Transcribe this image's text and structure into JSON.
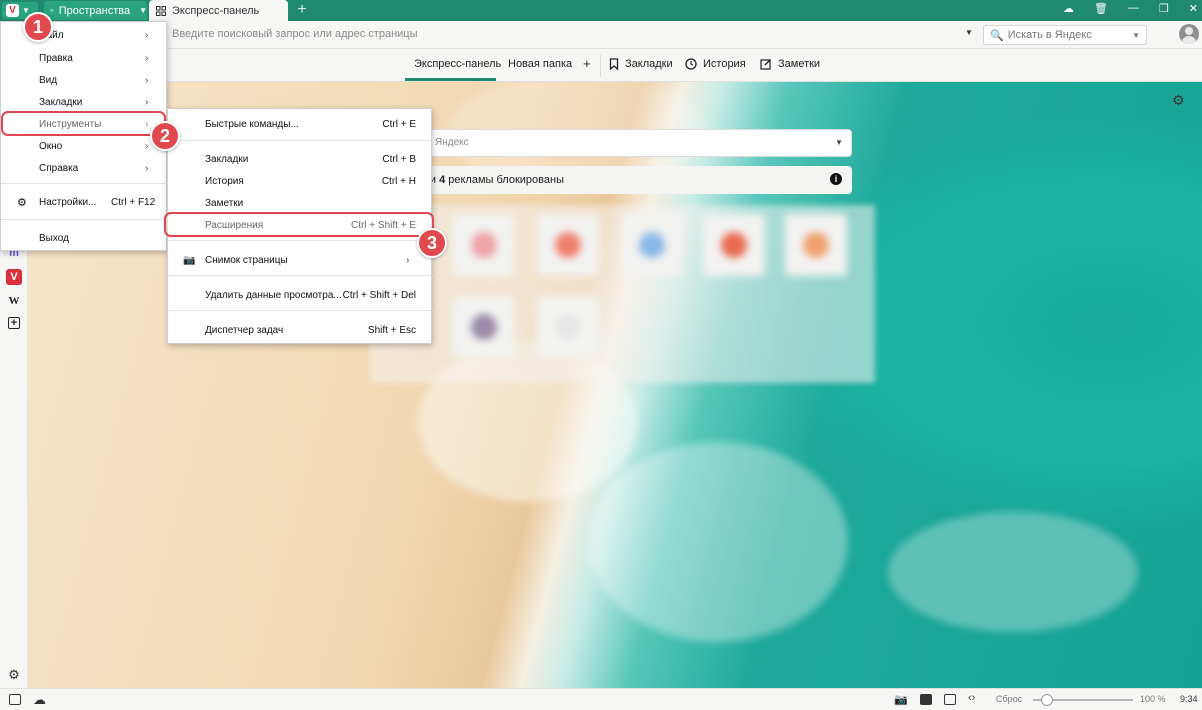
{
  "tabbar": {
    "spaces_label": "Пространства",
    "active_tab_label": "Экспресс-панель",
    "new_tab_symbol": "+"
  },
  "addressbar": {
    "url_placeholder": "Введите поисковый запрос или адрес страницы",
    "search_placeholder": "Искать в Яндекс"
  },
  "bookmarks_bar": {
    "items": [
      "Экспресс-панель",
      "Новая папка",
      "+"
    ],
    "tools": [
      "Закладки",
      "История",
      "Заметки"
    ]
  },
  "main_menu": {
    "items": [
      {
        "label": "Файл"
      },
      {
        "label": "Правка"
      },
      {
        "label": "Вид"
      },
      {
        "label": "Закладки"
      },
      {
        "label": "Инструменты"
      },
      {
        "label": "Окно"
      },
      {
        "label": "Справка"
      }
    ],
    "settings": {
      "label": "Настройки...",
      "shortcut": "Ctrl + F12"
    },
    "exit": {
      "label": "Выход"
    }
  },
  "tools_menu": {
    "items": [
      {
        "label": "Быстрые команды...",
        "shortcut": "Ctrl + E"
      },
      {
        "label": "Закладки",
        "shortcut": "Ctrl + B"
      },
      {
        "label": "История",
        "shortcut": "Ctrl + H"
      },
      {
        "label": "Заметки",
        "shortcut": ""
      },
      {
        "label": "Расширения",
        "shortcut": "Ctrl + Shift + E"
      },
      {
        "label": "Снимок страницы",
        "shortcut": ""
      },
      {
        "label": "Удалить данные просмотра...",
        "shortcut": "Ctrl + Shift + Del"
      },
      {
        "label": "Диспетчер задач",
        "shortcut": "Shift + Esc"
      }
    ]
  },
  "speed_dial": {
    "search_placeholder": "Яндекс",
    "ads_text_prefix": "к и ",
    "ads_count": "4",
    "ads_text_suffix": " рекламы блокированы",
    "tile_colors": [
      "#f0a3a8",
      "#f08070",
      "#8ab8e8",
      "#e86a50",
      "#f0a070",
      "#9a8aa8",
      "#e8e8e8"
    ]
  },
  "status_bar": {
    "reset_label": "Сброс",
    "zoom_percent": 100,
    "zoom_label": "100 %",
    "time": "9:34"
  },
  "annotations": [
    "1",
    "2",
    "3"
  ],
  "colors": {
    "accent": "#1f8a6e",
    "highlight": "#e2454f"
  }
}
